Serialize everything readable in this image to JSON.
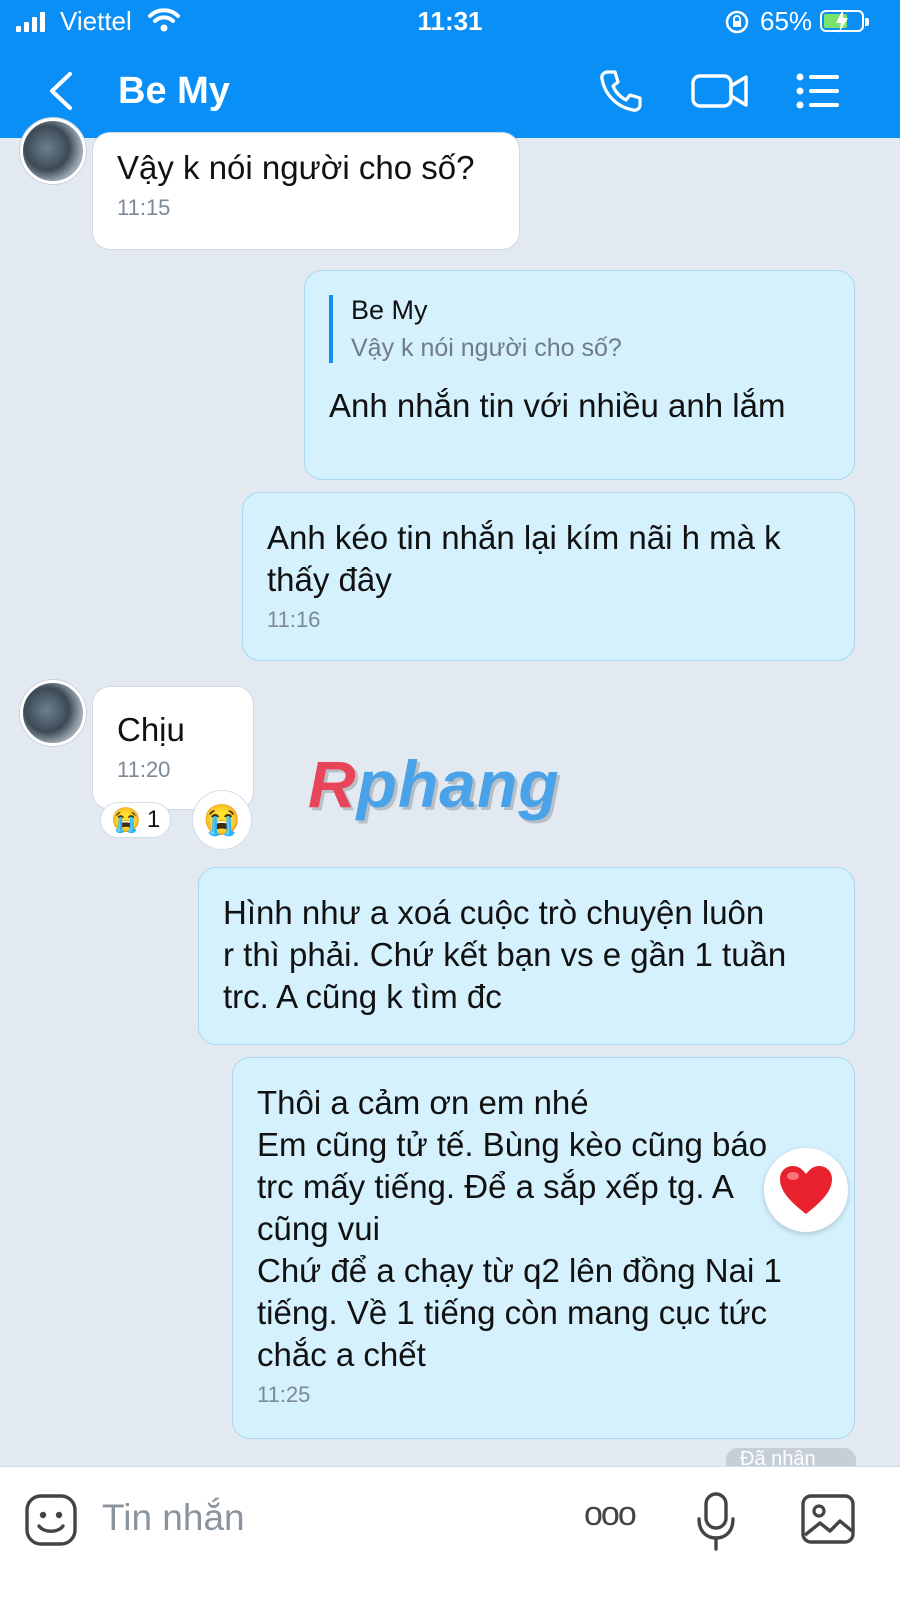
{
  "status_bar": {
    "carrier": "Viettel",
    "time": "11:31",
    "battery": "65%",
    "battery_level": 0.65
  },
  "header": {
    "title": "Be My",
    "icons": [
      "back-icon",
      "phone-icon",
      "video-icon",
      "menu-icon"
    ]
  },
  "messages": [
    {
      "direction": "in",
      "text": "Vậy k nói người cho số?",
      "time": "11:15"
    },
    {
      "direction": "out",
      "reply_to": {
        "name": "Be My",
        "text": "Vậy k nói người cho số?"
      },
      "text": "Anh nhắn tin với nhiều anh lắm"
    },
    {
      "direction": "out",
      "text": "Anh kéo tin nhắn lại kím nãi h mà k\nthấy đây",
      "time": "11:16"
    },
    {
      "direction": "in",
      "text": "Chịu",
      "time": "11:20",
      "reaction": {
        "emoji": "😭",
        "count": "1"
      }
    },
    {
      "direction": "out",
      "text": "Hình như a xoá cuộc trò chuyện luôn\nr thì phải. Chứ kết bạn vs e gần 1 tuần\ntrc. A cũng k tìm đc"
    },
    {
      "direction": "out",
      "text": "Thôi a cảm ơn em nhé\nEm cũng tử tế. Bùng kèo cũng báo\ntrc mấy tiếng. Để a sắp xếp tg. A\ncũng vui\nChứ để a chạy từ q2 lên đồng Nai 1\ntiếng. Về 1 tiếng còn mang cục tức\nchắc a chết",
      "time": "11:25"
    }
  ],
  "seen_label": "Đã nhận",
  "watermark": {
    "part1": "R",
    "part2": "phang"
  },
  "input_bar": {
    "placeholder": "Tin nhắn",
    "more_label": "ooo"
  },
  "colors": {
    "header": "#0a8ff7",
    "background": "#e2e9f1",
    "outgoing_bubble": "#d4f1fd",
    "incoming_bubble": "#ffffff"
  }
}
